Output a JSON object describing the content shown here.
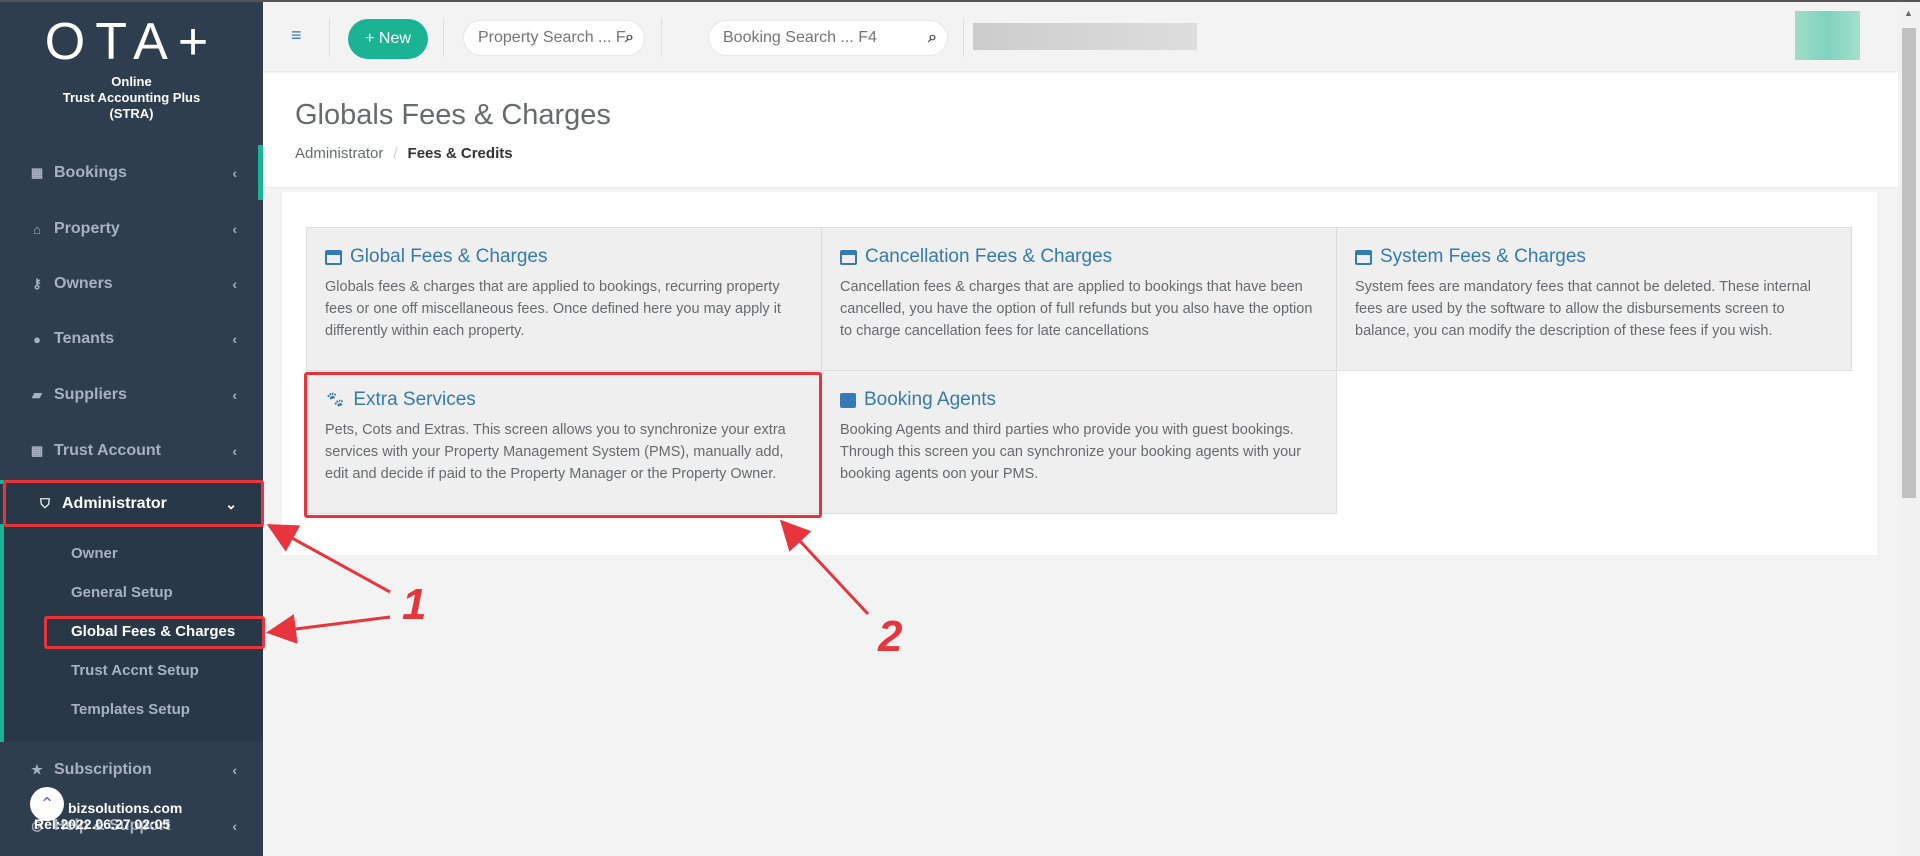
{
  "brand": {
    "logo": "OTA+",
    "line1": "Online",
    "line2": "Trust Accounting Plus",
    "line3": "(STRA)"
  },
  "sidebar": {
    "items": [
      {
        "label": "Bookings",
        "icon": "calendar-icon"
      },
      {
        "label": "Property",
        "icon": "home-icon"
      },
      {
        "label": "Owners",
        "icon": "key-icon"
      },
      {
        "label": "Tenants",
        "icon": "user-icon"
      },
      {
        "label": "Suppliers",
        "icon": "truck-icon"
      },
      {
        "label": "Trust Account",
        "icon": "calculator-icon"
      },
      {
        "label": "Administrator",
        "icon": "shield-icon"
      },
      {
        "label": "Subscription",
        "icon": "star-icon"
      },
      {
        "label": "Help & Support",
        "icon": "lifebuoy-icon"
      }
    ],
    "submenu": [
      "Owner",
      "General Setup",
      "Global Fees & Charges",
      "Trust Accnt Setup",
      "Templates Setup"
    ],
    "footer_site": "bizsolutions.com",
    "footer_rel": "Rel:2022.06.27 02:05"
  },
  "topbar": {
    "new_label": "+ New",
    "property_search_placeholder": "Property Search ... F2",
    "booking_search_placeholder": "Booking Search ... F4"
  },
  "page": {
    "title": "Globals Fees & Charges",
    "breadcrumb": [
      "Administrator",
      "Fees & Credits"
    ]
  },
  "cards": [
    {
      "title": "Global Fees & Charges",
      "icon": "credit-card-icon",
      "text": "Globals fees & charges that are applied to bookings, recurring property fees or one off miscellaneous fees. Once defined here you may apply it differently within each property."
    },
    {
      "title": "Cancellation Fees & Charges",
      "icon": "credit-card-icon",
      "text": "Cancellation fees & charges that are applied to bookings that have been cancelled, you have the option of full refunds but you also have the option to charge cancellation fees for late cancellations"
    },
    {
      "title": "System Fees & Charges",
      "icon": "credit-card-icon",
      "text": "System fees are mandatory fees that cannot be deleted. These internal fees are used by the software to allow the disbursements screen to balance, you can modify the description of these fees if you wish."
    },
    {
      "title": "Extra Services",
      "icon": "paw-icon",
      "text": "Pets, Cots and Extras. This screen allows you to synchronize your extra services with your Property Management System (PMS), manually add, edit and decide if paid to the Property Manager or the Property Owner."
    },
    {
      "title": "Booking Agents",
      "icon": "briefcase-icon",
      "text": "Booking Agents and third parties who provide you with guest bookings. Through this screen you can synchronize your booking agents with your booking agents oon your PMS."
    }
  ],
  "annotations": [
    "1",
    "2"
  ],
  "colors": {
    "accent": "#1ab394",
    "link": "#337ab7",
    "highlight": "#e8343c",
    "sidebar": "#2f3e4e"
  }
}
